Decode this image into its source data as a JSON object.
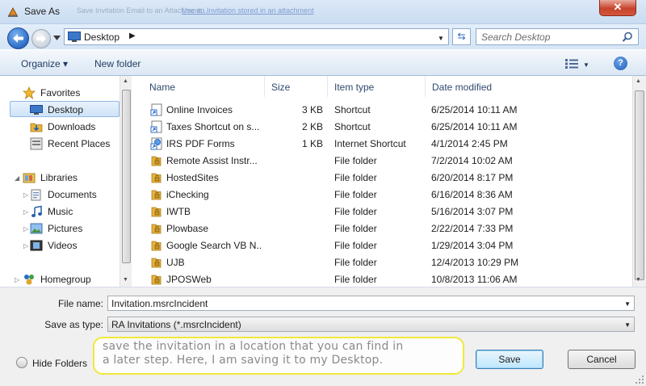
{
  "window": {
    "title": "Save As",
    "background_text": "Save Invitation Email to an Attachment...",
    "background_link": "Use an Invitation stored in an attachment"
  },
  "address": {
    "location": "Desktop",
    "separator": "▶",
    "search_placeholder": "Search Desktop"
  },
  "toolbar": {
    "organize_label": "Organize ▾",
    "new_folder_label": "New folder",
    "view_drop": "▼",
    "help_label": "?"
  },
  "sidebar": {
    "items": [
      {
        "label": "Favorites",
        "icon": "star-icon"
      },
      {
        "label": "Desktop",
        "icon": "desktop-icon",
        "selected": true
      },
      {
        "label": "Downloads",
        "icon": "downloads-icon"
      },
      {
        "label": "Recent Places",
        "icon": "recent-places-icon"
      },
      {
        "label": "Libraries",
        "icon": "libraries-icon"
      },
      {
        "label": "Documents",
        "icon": "documents-icon"
      },
      {
        "label": "Music",
        "icon": "music-icon"
      },
      {
        "label": "Pictures",
        "icon": "pictures-icon"
      },
      {
        "label": "Videos",
        "icon": "videos-icon"
      },
      {
        "label": "Homegroup",
        "icon": "homegroup-icon"
      }
    ]
  },
  "files": {
    "columns": {
      "name": "Name",
      "size": "Size",
      "type": "Item type",
      "date": "Date modified"
    },
    "rows": [
      {
        "name": "Online Invoices",
        "size": "3 KB",
        "type": "Shortcut",
        "date": "6/25/2014 10:11 AM",
        "icon": "shortcut-icon"
      },
      {
        "name": "Taxes Shortcut on s...",
        "size": "2 KB",
        "type": "Shortcut",
        "date": "6/25/2014 10:11 AM",
        "icon": "shortcut-icon"
      },
      {
        "name": "IRS PDF Forms",
        "size": "1 KB",
        "type": "Internet Shortcut",
        "date": "4/1/2014 2:45 PM",
        "icon": "internet-shortcut-icon"
      },
      {
        "name": "Remote Assist Instr...",
        "size": "",
        "type": "File folder",
        "date": "7/2/2014 10:02 AM",
        "icon": "locked-folder-icon"
      },
      {
        "name": "HostedSites",
        "size": "",
        "type": "File folder",
        "date": "6/20/2014 8:17 PM",
        "icon": "locked-folder-icon"
      },
      {
        "name": "iChecking",
        "size": "",
        "type": "File folder",
        "date": "6/16/2014 8:36 AM",
        "icon": "locked-folder-icon"
      },
      {
        "name": "IWTB",
        "size": "",
        "type": "File folder",
        "date": "5/16/2014 3:07 PM",
        "icon": "locked-folder-icon"
      },
      {
        "name": "Plowbase",
        "size": "",
        "type": "File folder",
        "date": "2/22/2014 7:33 PM",
        "icon": "locked-folder-icon"
      },
      {
        "name": "Google Search VB N...",
        "size": "",
        "type": "File folder",
        "date": "1/29/2014 3:04 PM",
        "icon": "locked-folder-icon"
      },
      {
        "name": "UJB",
        "size": "",
        "type": "File folder",
        "date": "12/4/2013 10:29 PM",
        "icon": "locked-folder-icon"
      },
      {
        "name": "JPOSWeb",
        "size": "",
        "type": "File folder",
        "date": "10/8/2013 11:06 AM",
        "icon": "locked-folder-icon"
      }
    ]
  },
  "form": {
    "file_name_label": "File name:",
    "file_name_value": "Invitation.msrcIncident",
    "save_type_label": "Save as type:",
    "save_type_value": "RA Invitations (*.msrcIncident)"
  },
  "footer": {
    "hide_folders_label": "Hide Folders",
    "note_line1": "save the invitation in a location that you can find in",
    "note_line2": "a later step. Here, I am saving it to my Desktop.",
    "save_label": "Save",
    "cancel_label": "Cancel"
  },
  "colors": {
    "accent": "#2a6cc8",
    "note_border": "#f2e83a",
    "folder_gold": "#e8b23a"
  }
}
